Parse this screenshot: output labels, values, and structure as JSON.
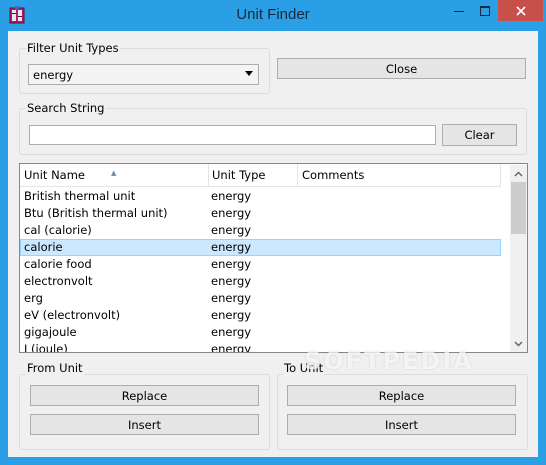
{
  "window": {
    "title": "Unit Finder",
    "title_bar_color": "#2a9fe6",
    "icons": {
      "app": "unit-finder-app-icon",
      "minimize": "minimize-icon",
      "maximize": "maximize-icon",
      "close": "close-icon"
    }
  },
  "filter": {
    "label": "Filter Unit Types",
    "selected": "energy"
  },
  "close_button": {
    "label": "Close"
  },
  "search": {
    "label": "Search String",
    "value": "",
    "clear_label": "Clear"
  },
  "table": {
    "columns": [
      "Unit Name",
      "Unit Type",
      "Comments"
    ],
    "sort_column": "Unit Name",
    "rows": [
      {
        "name": "British thermal unit",
        "type": "energy",
        "comment": ""
      },
      {
        "name": "Btu  (British thermal unit)",
        "type": "energy",
        "comment": ""
      },
      {
        "name": "cal  (calorie)",
        "type": "energy",
        "comment": ""
      },
      {
        "name": "calorie",
        "type": "energy",
        "comment": "",
        "selected": true
      },
      {
        "name": "calorie food",
        "type": "energy",
        "comment": ""
      },
      {
        "name": "electronvolt",
        "type": "energy",
        "comment": ""
      },
      {
        "name": "erg",
        "type": "energy",
        "comment": ""
      },
      {
        "name": "eV  (electronvolt)",
        "type": "energy",
        "comment": ""
      },
      {
        "name": "gigajoule",
        "type": "energy",
        "comment": ""
      },
      {
        "name": "J  (joule)",
        "type": "energy",
        "comment": ""
      }
    ],
    "selected_color": "#cce8ff"
  },
  "from_unit": {
    "label": "From Unit",
    "replace_label": "Replace",
    "insert_label": "Insert"
  },
  "to_unit": {
    "label": "To Unit",
    "replace_label": "Replace",
    "insert_label": "Insert"
  },
  "watermark": "SOFTPEDIA"
}
